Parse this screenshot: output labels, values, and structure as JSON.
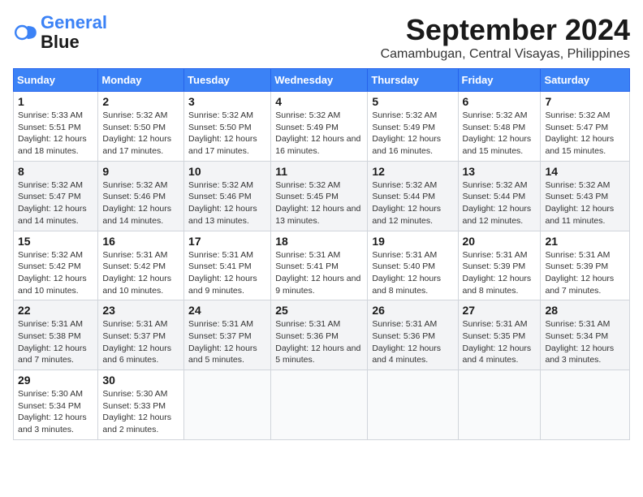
{
  "logo": {
    "line1": "General",
    "line2": "Blue"
  },
  "title": "September 2024",
  "location": "Camambugan, Central Visayas, Philippines",
  "weekdays": [
    "Sunday",
    "Monday",
    "Tuesday",
    "Wednesday",
    "Thursday",
    "Friday",
    "Saturday"
  ],
  "weeks": [
    [
      {
        "day": "1",
        "sunrise": "Sunrise: 5:33 AM",
        "sunset": "Sunset: 5:51 PM",
        "daylight": "Daylight: 12 hours and 18 minutes."
      },
      {
        "day": "2",
        "sunrise": "Sunrise: 5:32 AM",
        "sunset": "Sunset: 5:50 PM",
        "daylight": "Daylight: 12 hours and 17 minutes."
      },
      {
        "day": "3",
        "sunrise": "Sunrise: 5:32 AM",
        "sunset": "Sunset: 5:50 PM",
        "daylight": "Daylight: 12 hours and 17 minutes."
      },
      {
        "day": "4",
        "sunrise": "Sunrise: 5:32 AM",
        "sunset": "Sunset: 5:49 PM",
        "daylight": "Daylight: 12 hours and 16 minutes."
      },
      {
        "day": "5",
        "sunrise": "Sunrise: 5:32 AM",
        "sunset": "Sunset: 5:49 PM",
        "daylight": "Daylight: 12 hours and 16 minutes."
      },
      {
        "day": "6",
        "sunrise": "Sunrise: 5:32 AM",
        "sunset": "Sunset: 5:48 PM",
        "daylight": "Daylight: 12 hours and 15 minutes."
      },
      {
        "day": "7",
        "sunrise": "Sunrise: 5:32 AM",
        "sunset": "Sunset: 5:47 PM",
        "daylight": "Daylight: 12 hours and 15 minutes."
      }
    ],
    [
      {
        "day": "8",
        "sunrise": "Sunrise: 5:32 AM",
        "sunset": "Sunset: 5:47 PM",
        "daylight": "Daylight: 12 hours and 14 minutes."
      },
      {
        "day": "9",
        "sunrise": "Sunrise: 5:32 AM",
        "sunset": "Sunset: 5:46 PM",
        "daylight": "Daylight: 12 hours and 14 minutes."
      },
      {
        "day": "10",
        "sunrise": "Sunrise: 5:32 AM",
        "sunset": "Sunset: 5:46 PM",
        "daylight": "Daylight: 12 hours and 13 minutes."
      },
      {
        "day": "11",
        "sunrise": "Sunrise: 5:32 AM",
        "sunset": "Sunset: 5:45 PM",
        "daylight": "Daylight: 12 hours and 13 minutes."
      },
      {
        "day": "12",
        "sunrise": "Sunrise: 5:32 AM",
        "sunset": "Sunset: 5:44 PM",
        "daylight": "Daylight: 12 hours and 12 minutes."
      },
      {
        "day": "13",
        "sunrise": "Sunrise: 5:32 AM",
        "sunset": "Sunset: 5:44 PM",
        "daylight": "Daylight: 12 hours and 12 minutes."
      },
      {
        "day": "14",
        "sunrise": "Sunrise: 5:32 AM",
        "sunset": "Sunset: 5:43 PM",
        "daylight": "Daylight: 12 hours and 11 minutes."
      }
    ],
    [
      {
        "day": "15",
        "sunrise": "Sunrise: 5:32 AM",
        "sunset": "Sunset: 5:42 PM",
        "daylight": "Daylight: 12 hours and 10 minutes."
      },
      {
        "day": "16",
        "sunrise": "Sunrise: 5:31 AM",
        "sunset": "Sunset: 5:42 PM",
        "daylight": "Daylight: 12 hours and 10 minutes."
      },
      {
        "day": "17",
        "sunrise": "Sunrise: 5:31 AM",
        "sunset": "Sunset: 5:41 PM",
        "daylight": "Daylight: 12 hours and 9 minutes."
      },
      {
        "day": "18",
        "sunrise": "Sunrise: 5:31 AM",
        "sunset": "Sunset: 5:41 PM",
        "daylight": "Daylight: 12 hours and 9 minutes."
      },
      {
        "day": "19",
        "sunrise": "Sunrise: 5:31 AM",
        "sunset": "Sunset: 5:40 PM",
        "daylight": "Daylight: 12 hours and 8 minutes."
      },
      {
        "day": "20",
        "sunrise": "Sunrise: 5:31 AM",
        "sunset": "Sunset: 5:39 PM",
        "daylight": "Daylight: 12 hours and 8 minutes."
      },
      {
        "day": "21",
        "sunrise": "Sunrise: 5:31 AM",
        "sunset": "Sunset: 5:39 PM",
        "daylight": "Daylight: 12 hours and 7 minutes."
      }
    ],
    [
      {
        "day": "22",
        "sunrise": "Sunrise: 5:31 AM",
        "sunset": "Sunset: 5:38 PM",
        "daylight": "Daylight: 12 hours and 7 minutes."
      },
      {
        "day": "23",
        "sunrise": "Sunrise: 5:31 AM",
        "sunset": "Sunset: 5:37 PM",
        "daylight": "Daylight: 12 hours and 6 minutes."
      },
      {
        "day": "24",
        "sunrise": "Sunrise: 5:31 AM",
        "sunset": "Sunset: 5:37 PM",
        "daylight": "Daylight: 12 hours and 5 minutes."
      },
      {
        "day": "25",
        "sunrise": "Sunrise: 5:31 AM",
        "sunset": "Sunset: 5:36 PM",
        "daylight": "Daylight: 12 hours and 5 minutes."
      },
      {
        "day": "26",
        "sunrise": "Sunrise: 5:31 AM",
        "sunset": "Sunset: 5:36 PM",
        "daylight": "Daylight: 12 hours and 4 minutes."
      },
      {
        "day": "27",
        "sunrise": "Sunrise: 5:31 AM",
        "sunset": "Sunset: 5:35 PM",
        "daylight": "Daylight: 12 hours and 4 minutes."
      },
      {
        "day": "28",
        "sunrise": "Sunrise: 5:31 AM",
        "sunset": "Sunset: 5:34 PM",
        "daylight": "Daylight: 12 hours and 3 minutes."
      }
    ],
    [
      {
        "day": "29",
        "sunrise": "Sunrise: 5:30 AM",
        "sunset": "Sunset: 5:34 PM",
        "daylight": "Daylight: 12 hours and 3 minutes."
      },
      {
        "day": "30",
        "sunrise": "Sunrise: 5:30 AM",
        "sunset": "Sunset: 5:33 PM",
        "daylight": "Daylight: 12 hours and 2 minutes."
      },
      null,
      null,
      null,
      null,
      null
    ]
  ]
}
